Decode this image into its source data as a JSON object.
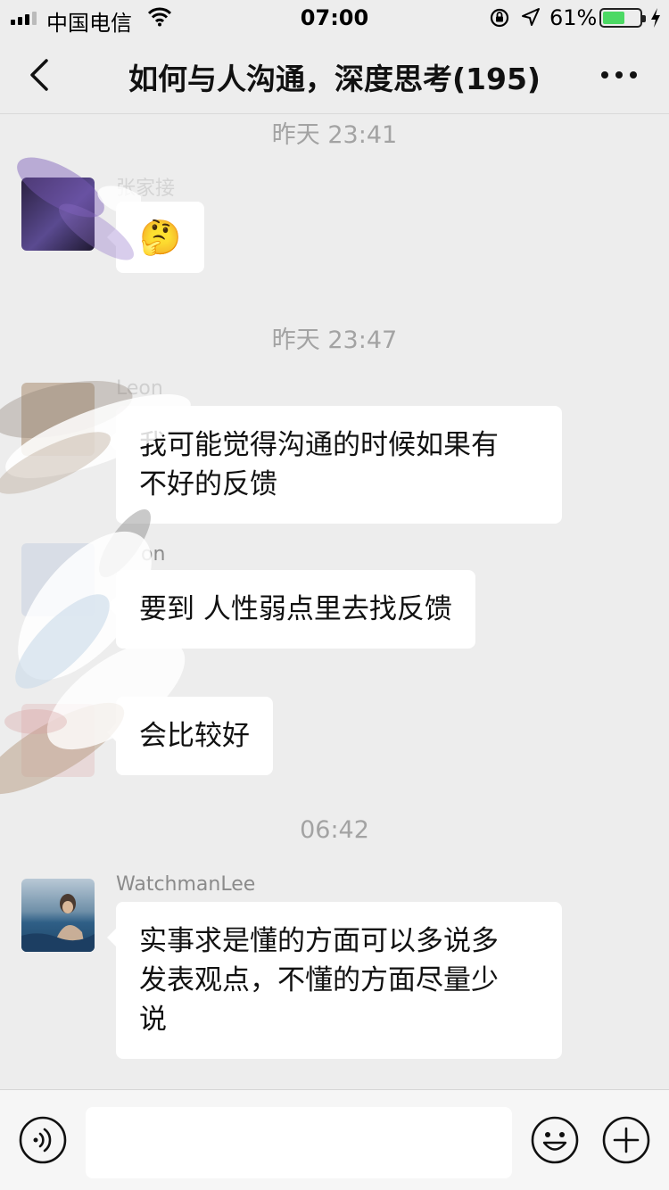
{
  "status_bar": {
    "carrier": "中国电信",
    "time": "07:00",
    "battery_percent": "61%",
    "battery_level": 0.61,
    "icons": [
      "signal-icon",
      "wifi-icon",
      "rotation-lock-icon",
      "location-arrow-icon",
      "battery-icon",
      "charging-bolt-icon"
    ]
  },
  "nav": {
    "title": "如何与人沟通，深度思考(195)",
    "back_icon": "chevron-left-icon",
    "more_icon": "ellipsis-icon"
  },
  "messages": {
    "ts1": "昨天 23:41",
    "msg1": {
      "sender": "张家接",
      "text": "🤔",
      "emoji_name": "thinking-face"
    },
    "ts2": "昨天 23:47",
    "msg2": {
      "sender": "Leon",
      "text": "我可能觉得沟通的时候如果有\n不好的反馈"
    },
    "msg3": {
      "sender": "on",
      "text": "要到 人性弱点里去找反馈"
    },
    "msg4": {
      "text": "会比较好"
    },
    "ts3": "06:42",
    "msg5": {
      "sender": "WatchmanLee",
      "text": "实事求是懂的方面可以多说多\n发表观点，不懂的方面尽量少\n说"
    }
  },
  "input_bar": {
    "input_value": "",
    "icons": [
      "voice-icon",
      "emoji-icon",
      "plus-icon"
    ]
  },
  "colors": {
    "background": "#ededed",
    "bubble": "#ffffff",
    "timestamp": "#a3a3a3",
    "battery_fill": "#4cd964"
  }
}
